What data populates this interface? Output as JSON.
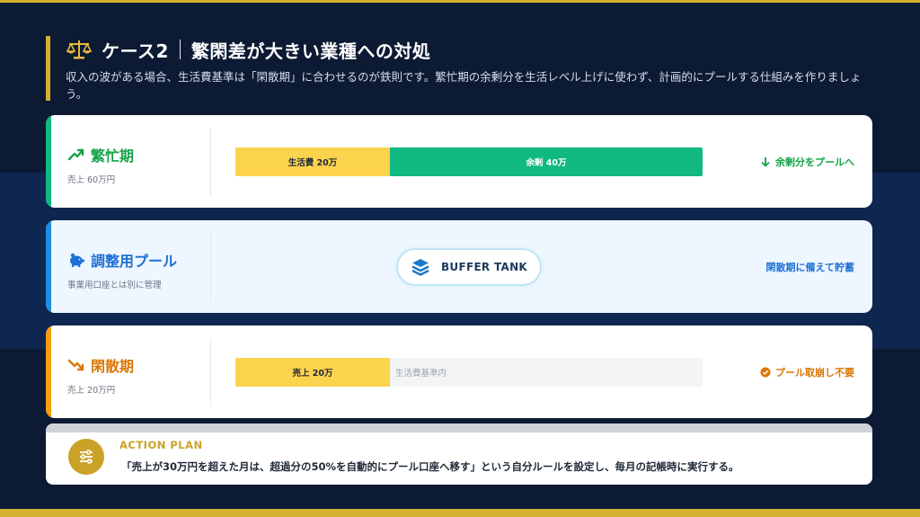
{
  "header": {
    "title": "ケース2",
    "title_main": "繁閑差が大きい業種への対処",
    "subtitle": "収入の波がある場合、生活費基準は「閑散期」に合わせるのが鉄則です。繁忙期の余剰分を生活レベル上げに使わず、計画的にプールする仕組みを作りましょう。"
  },
  "cards": [
    {
      "label": "繁忙期",
      "sub": "売上 60万円",
      "icon": "trending-up-icon",
      "color": "#16a34a",
      "bar": [
        {
          "text": "生活費 20万",
          "fraction": 0.333,
          "color": "#fcd34d"
        },
        {
          "text": "余剰 40万",
          "fraction": 0.667,
          "color": "#10b981"
        }
      ],
      "note": "余剰分をプールへ",
      "note_icon": "arrow-down-icon"
    },
    {
      "label": "調整用プール",
      "sub": "事業用口座とは別に管理",
      "icon": "piggy-bank-icon",
      "color": "#1d6fd6",
      "pill": "BUFFER TANK",
      "pill_icon": "layers-icon",
      "note": "閑散期に備えて貯蓄"
    },
    {
      "label": "閑散期",
      "sub": "売上 20万円",
      "icon": "trending-down-icon",
      "color": "#d97706",
      "bar": [
        {
          "text": "売上 20万",
          "fraction": 0.333,
          "color": "#fcd34d"
        },
        {
          "text": "生活費基準内",
          "fraction": 0.667,
          "color": "#f3f4f6"
        }
      ],
      "note": "プール取崩し不要",
      "note_icon": "check-circle-icon"
    }
  ],
  "action": {
    "title": "ACTION PLAN",
    "text": "「売上が30万円を超えた月は、超過分の50%を自動的にプール口座へ移す」という自分ルールを設定し、毎月の記帳時に実行する。",
    "icon": "sliders-icon"
  },
  "colors": {
    "accent": "#d4b12f",
    "background": "#0c1a33"
  }
}
